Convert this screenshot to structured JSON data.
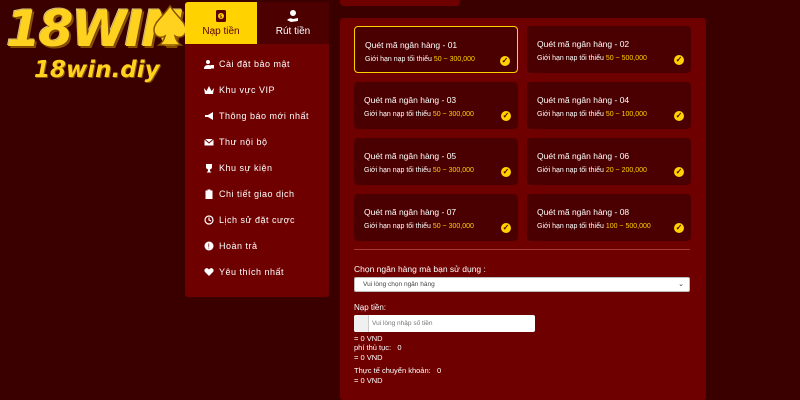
{
  "logo": {
    "main": "18WIN",
    "sub": "18win.diy"
  },
  "tabs": [
    {
      "label": "Nạp tiền",
      "icon": "deposit-icon",
      "active": true
    },
    {
      "label": "Rút tiền",
      "icon": "withdraw-icon",
      "active": false
    }
  ],
  "menu": [
    {
      "label": "Cài đặt bảo mật",
      "icon": "user-lock-icon"
    },
    {
      "label": "Khu vực VIP",
      "icon": "crown-icon"
    },
    {
      "label": "Thông báo mới nhất",
      "icon": "megaphone-icon"
    },
    {
      "label": "Thư nội bộ",
      "icon": "mail-icon"
    },
    {
      "label": "Khu sự kiện",
      "icon": "trophy-icon"
    },
    {
      "label": "Chi tiết giao dịch",
      "icon": "clipboard-icon"
    },
    {
      "label": "Lịch sử đặt cược",
      "icon": "history-icon"
    },
    {
      "label": "Hoàn trả",
      "icon": "refund-icon"
    },
    {
      "label": "Yêu thích nhất",
      "icon": "heart-icon"
    }
  ],
  "cards": [
    {
      "title": "Quét mã ngân hàng - 01",
      "limit_label": "Giới hạn nạp tối thiểu",
      "range": "50 ~ 300,000",
      "selected": true
    },
    {
      "title": "Quét mã ngân hàng - 02",
      "limit_label": "Giới hạn nạp tối thiểu",
      "range": "50 ~ 500,000",
      "selected": false
    },
    {
      "title": "Quét mã ngân hàng - 03",
      "limit_label": "Giới hạn nạp tối thiểu",
      "range": "50 ~ 300,000",
      "selected": false
    },
    {
      "title": "Quét mã ngân hàng - 04",
      "limit_label": "Giới hạn nạp tối thiểu",
      "range": "50 ~ 100,000",
      "selected": false
    },
    {
      "title": "Quét mã ngân hàng - 05",
      "limit_label": "Giới hạn nạp tối thiểu",
      "range": "50 ~ 300,000",
      "selected": false
    },
    {
      "title": "Quét mã ngân hàng - 06",
      "limit_label": "Giới hạn nạp tối thiểu",
      "range": "20 ~ 200,000",
      "selected": false
    },
    {
      "title": "Quét mã ngân hàng - 07",
      "limit_label": "Giới hạn nạp tối thiểu",
      "range": "50 ~ 300,000",
      "selected": false
    },
    {
      "title": "Quét mã ngân hàng - 08",
      "limit_label": "Giới hạn nạp tối thiểu",
      "range": "100 ~ 500,000",
      "selected": false
    }
  ],
  "check_glyph": "✓",
  "form": {
    "bank_label": "Chọn ngân hàng mà bạn sử dụng :",
    "bank_placeholder": "Vui lòng chọn ngân hàng",
    "amount_label": "Nạp tiền:",
    "amount_placeholder": "Vui lòng nhập số tiền",
    "amount_vnd": "= 0 VND",
    "fee_label": "phí thủ tục:",
    "fee_value": "0",
    "fee_vnd": "= 0 VND",
    "actual_label": "Thực tế chuyển khoản:",
    "actual_value": "0",
    "actual_vnd": "= 0 VND"
  },
  "colors": {
    "accent": "#ffd200",
    "panel": "#6e0000",
    "background": "#3a0000",
    "card": "#4a0000"
  }
}
